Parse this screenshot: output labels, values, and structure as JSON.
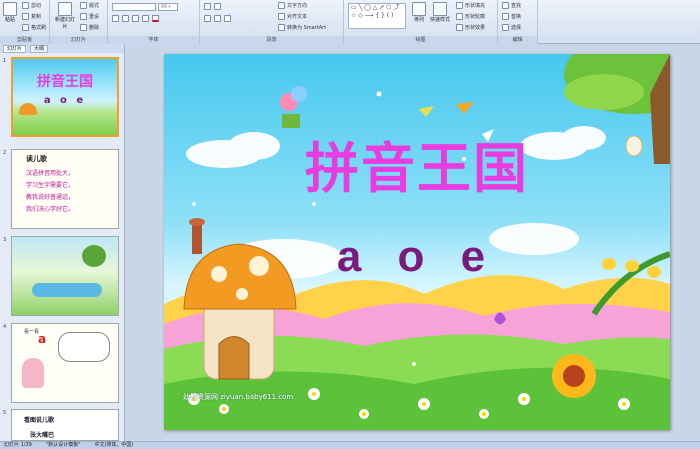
{
  "ribbon": {
    "clipboard": {
      "paste": "粘贴",
      "cut": "剪切",
      "copy": "复制",
      "format_painter": "格式刷",
      "label": "剪贴板"
    },
    "slides": {
      "new_slide": "新建幻灯片",
      "layout": "版式",
      "reset": "重设",
      "delete": "删除",
      "label": "幻灯片"
    },
    "font": {
      "font_size": "66+",
      "label": "字体"
    },
    "paragraph": {
      "text_direction": "文字方向",
      "align_text": "对齐文本",
      "smartart": "转换为 SmartArt",
      "label": "段落"
    },
    "drawing": {
      "arrange": "排列",
      "quick_styles": "快速样式",
      "shape_fill": "形状填充",
      "shape_outline": "形状轮廓",
      "shape_effects": "形状效果",
      "label": "绘图"
    },
    "editing": {
      "find": "查找",
      "replace": "替换",
      "select": "选择",
      "label": "编辑"
    }
  },
  "left_pane": {
    "tabs": [
      "幻灯片",
      "大纲"
    ],
    "thumbs": [
      {
        "num": "1",
        "title": "拼音王国",
        "sub": "a o e"
      },
      {
        "num": "2",
        "heading": "读儿歌",
        "lines": [
          "汉语拼音用处大，",
          "学习生字需要它，",
          "教我说好普通话，",
          "我们决心学好它。"
        ]
      },
      {
        "num": "3"
      },
      {
        "num": "4",
        "heading": "看一看",
        "letter": "a"
      },
      {
        "num": "5",
        "heading": "看图说儿歌",
        "sub": "张大嘴巴"
      }
    ]
  },
  "slide": {
    "title": "拼音王国",
    "letters": "a o e",
    "watermark": "幼教资源网 ziyuan.baby611.com"
  },
  "status": {
    "slide": "幻灯片 1/39",
    "theme": "\"默认设计模板\"",
    "lang": "中文(简体，中国)"
  },
  "colors": {
    "title": "#e93ce0",
    "letters": "#7a1a7d",
    "sky": "#46c8ef",
    "selected_thumb": "#f0a030"
  }
}
